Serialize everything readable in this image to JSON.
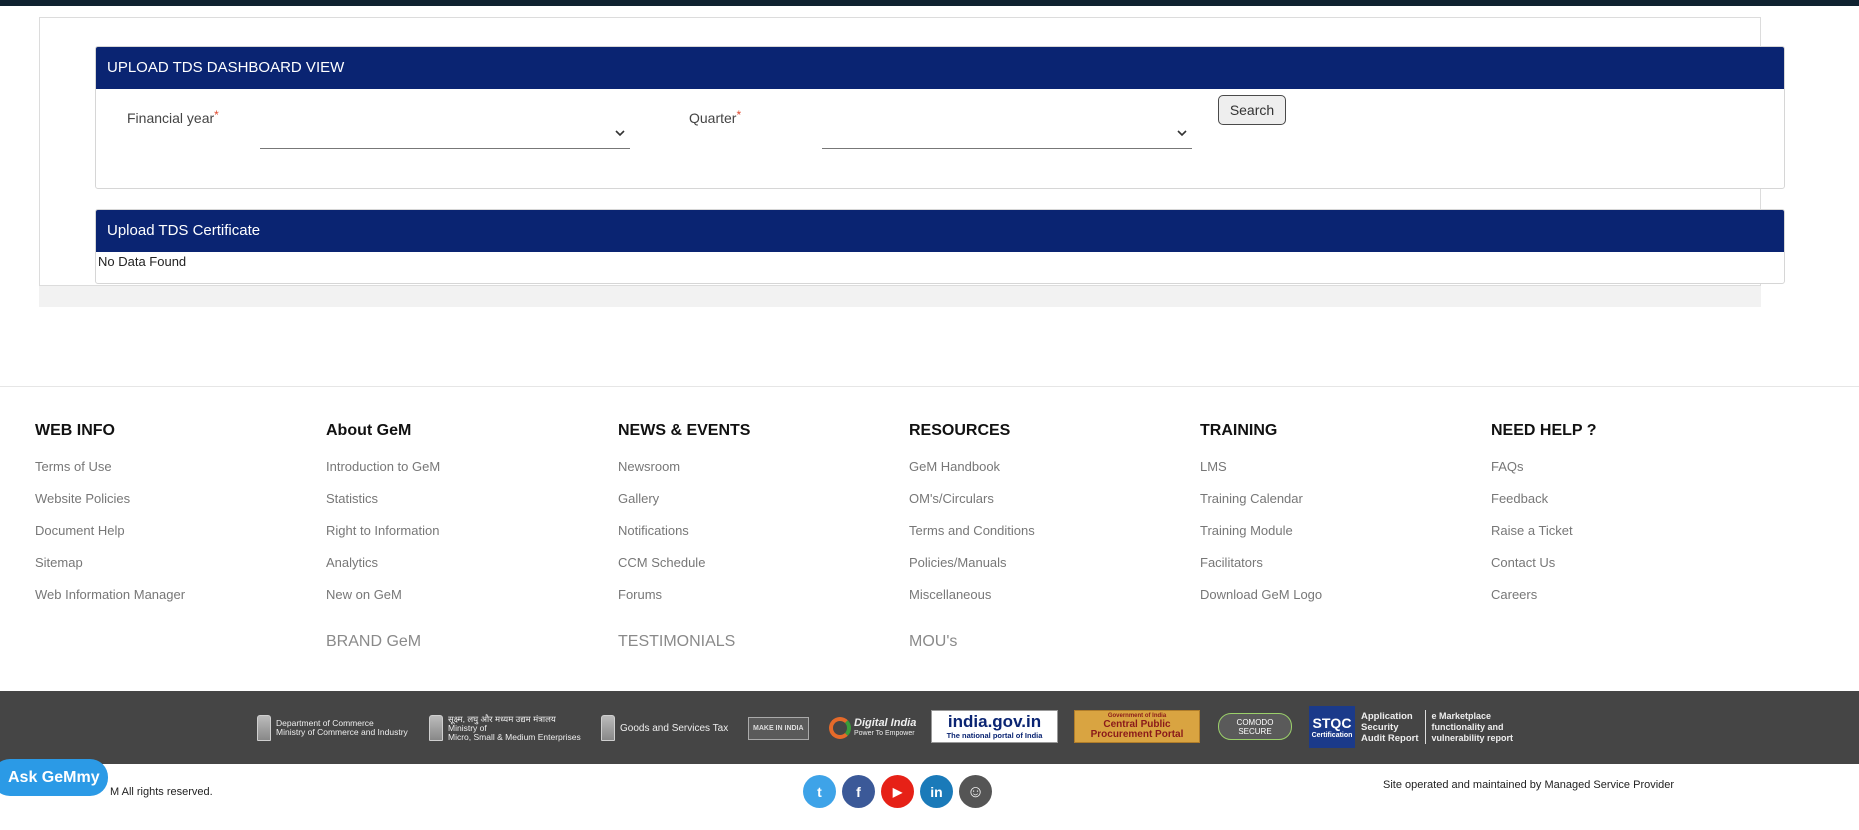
{
  "dashboard": {
    "title": "UPLOAD TDS DASHBOARD VIEW",
    "financial_year_label": "Financial year",
    "financial_year_value": "",
    "quarter_label": "Quarter",
    "quarter_value": "",
    "required_mark": "*",
    "search_label": "Search"
  },
  "certificate": {
    "title": "Upload TDS Certificate",
    "empty_text": "No Data Found"
  },
  "footer": {
    "columns": [
      {
        "title": "WEB INFO",
        "items": [
          "Terms of Use",
          "Website Policies",
          "Document Help",
          "Sitemap",
          "Web Information Manager"
        ],
        "extra": ""
      },
      {
        "title": "About GeM",
        "items": [
          "Introduction to GeM",
          "Statistics",
          "Right to Information",
          "Analytics",
          "New on GeM"
        ],
        "extra": "BRAND GeM"
      },
      {
        "title": "NEWS & EVENTS",
        "items": [
          "Newsroom",
          "Gallery",
          "Notifications",
          "CCM Schedule",
          "Forums"
        ],
        "extra": "TESTIMONIALS"
      },
      {
        "title": "RESOURCES",
        "items": [
          "GeM Handbook",
          "OM's/Circulars",
          "Terms and Conditions",
          "Policies/Manuals",
          "Miscellaneous"
        ],
        "extra": "MOU's"
      },
      {
        "title": "TRAINING",
        "items": [
          "LMS",
          "Training Calendar",
          "Training Module",
          "Facilitators",
          "Download GeM Logo"
        ],
        "extra": ""
      },
      {
        "title": "NEED HELP ?",
        "items": [
          "FAQs",
          "Feedback",
          "Raise a Ticket",
          "Contact Us",
          "Careers"
        ],
        "extra": ""
      }
    ],
    "partners": {
      "doc_line1": "Department of Commerce",
      "doc_line2": "Ministry of Commerce and Industry",
      "msme_line1": "सूक्ष्म, लघु और मध्यम उद्यम मंत्रालय",
      "msme_line2": "Ministry of",
      "msme_line3": "Micro, Small & Medium Enterprises",
      "gst": "Goods and Services Tax",
      "make_in_india": "MAKE IN INDIA",
      "digital_india_1": "Digital India",
      "digital_india_2": "Power To Empower",
      "india_gov_1": "india.gov.in",
      "india_gov_2": "The national portal of India",
      "cppp_1": "Government of India",
      "cppp_2": "Central Public",
      "cppp_3": "Procurement Portal",
      "comodo_1": "COMODO",
      "comodo_2": "SECURE",
      "stqc": "STQC",
      "stqc_sub": "Certification",
      "stqc_text_1": "Application",
      "stqc_text_2": "Security",
      "stqc_text_3": "Audit Report",
      "emp_1": "e Marketplace",
      "emp_2": "functionality and",
      "emp_3": "vulnerability report"
    },
    "rights": "M All rights reserved.",
    "operated": "Site operated and maintained by Managed Service Provider",
    "social": [
      {
        "name": "twitter",
        "glyph": "t",
        "color": "#3ea3e8"
      },
      {
        "name": "facebook",
        "glyph": "f",
        "color": "#3b5998"
      },
      {
        "name": "youtube",
        "glyph": "▶",
        "color": "#e62117"
      },
      {
        "name": "linkedin",
        "glyph": "in",
        "color": "#1a7ab9"
      },
      {
        "name": "koo",
        "glyph": "☺",
        "color": "#555555"
      }
    ]
  },
  "assistant": {
    "label": "Ask GeMmy"
  }
}
